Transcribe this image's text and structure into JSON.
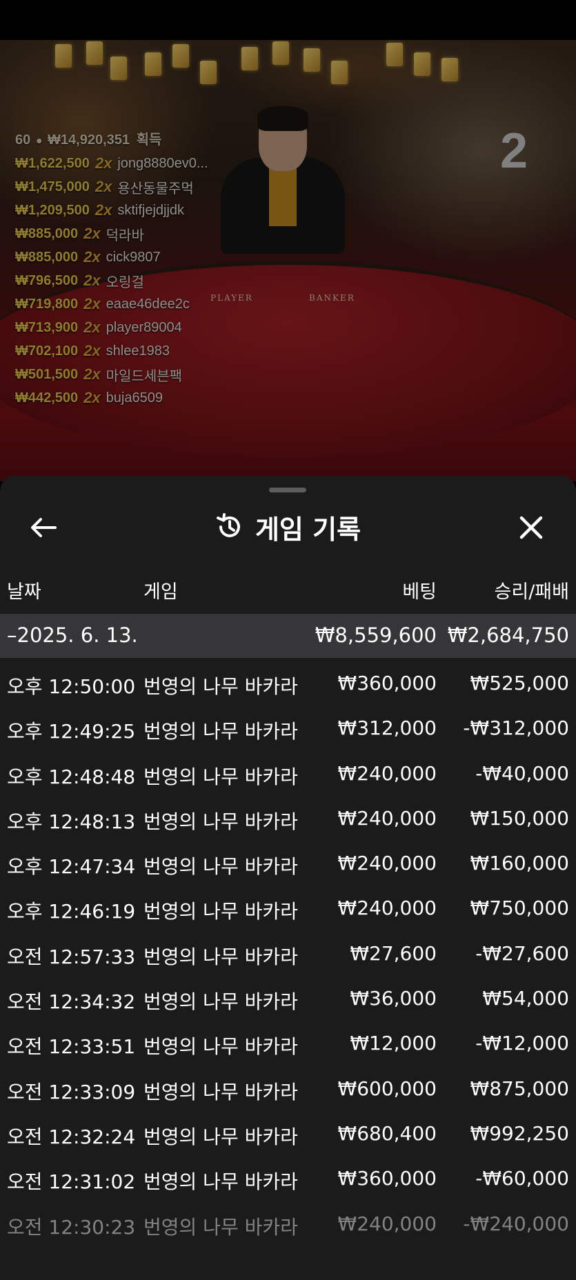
{
  "stream": {
    "timer": "2",
    "table_labels": [
      "PLAYER",
      "BANKER"
    ],
    "winners_summary": {
      "count": "60",
      "total": "₩14,920,351",
      "suffix": "획득"
    },
    "winners": [
      {
        "amount": "₩1,622,500",
        "mult": "2x",
        "name": "jong8880ev0..."
      },
      {
        "amount": "₩1,475,000",
        "mult": "2x",
        "name": "용산동물주먹"
      },
      {
        "amount": "₩1,209,500",
        "mult": "2x",
        "name": "sktifjejdjjdk"
      },
      {
        "amount": "₩885,000",
        "mult": "2x",
        "name": "덕라바"
      },
      {
        "amount": "₩885,000",
        "mult": "2x",
        "name": "cick9807"
      },
      {
        "amount": "₩796,500",
        "mult": "2x",
        "name": "오링걸"
      },
      {
        "amount": "₩719,800",
        "mult": "2x",
        "name": "eaae46dee2c"
      },
      {
        "amount": "₩713,900",
        "mult": "2x",
        "name": "player89004"
      },
      {
        "amount": "₩702,100",
        "mult": "2x",
        "name": "shlee1983"
      },
      {
        "amount": "₩501,500",
        "mult": "2x",
        "name": "마일드세븐팩"
      },
      {
        "amount": "₩442,500",
        "mult": "2x",
        "name": "buja6509"
      }
    ]
  },
  "sheet": {
    "title": "게임 기록",
    "icons": {
      "back": "arrow-left-icon",
      "history": "history-icon",
      "close": "close-icon"
    },
    "columns": {
      "date": "날짜",
      "game": "게임",
      "bet": "베팅",
      "result": "승리/패배"
    },
    "date_group": {
      "date": "–2025. 6. 13.",
      "bet_total": "₩8,559,600",
      "result_total": "₩2,684,750"
    },
    "rows": [
      {
        "time": "오후 12:50:00",
        "game": "번영의 나무 바카라",
        "bet": "₩360,000",
        "result": "₩525,000"
      },
      {
        "time": "오후 12:49:25",
        "game": "번영의 나무 바카라",
        "bet": "₩312,000",
        "result": "-₩312,000"
      },
      {
        "time": "오후 12:48:48",
        "game": "번영의 나무 바카라",
        "bet": "₩240,000",
        "result": "-₩40,000"
      },
      {
        "time": "오후 12:48:13",
        "game": "번영의 나무 바카라",
        "bet": "₩240,000",
        "result": "₩150,000"
      },
      {
        "time": "오후 12:47:34",
        "game": "번영의 나무 바카라",
        "bet": "₩240,000",
        "result": "₩160,000"
      },
      {
        "time": "오후 12:46:19",
        "game": "번영의 나무 바카라",
        "bet": "₩240,000",
        "result": "₩750,000"
      },
      {
        "time": "오전 12:57:33",
        "game": "번영의 나무 바카라",
        "bet": "₩27,600",
        "result": "-₩27,600"
      },
      {
        "time": "오전 12:34:32",
        "game": "번영의 나무 바카라",
        "bet": "₩36,000",
        "result": "₩54,000"
      },
      {
        "time": "오전 12:33:51",
        "game": "번영의 나무 바카라",
        "bet": "₩12,000",
        "result": "-₩12,000"
      },
      {
        "time": "오전 12:33:09",
        "game": "번영의 나무 바카라",
        "bet": "₩600,000",
        "result": "₩875,000"
      },
      {
        "time": "오전 12:32:24",
        "game": "번영의 나무 바카라",
        "bet": "₩680,400",
        "result": "₩992,250"
      },
      {
        "time": "오전 12:31:02",
        "game": "번영의 나무 바카라",
        "bet": "₩360,000",
        "result": "-₩60,000"
      },
      {
        "time": "오전 12:30:23",
        "game": "번영의 나무 바카라",
        "bet": "₩240,000",
        "result": "-₩240,000"
      }
    ]
  }
}
